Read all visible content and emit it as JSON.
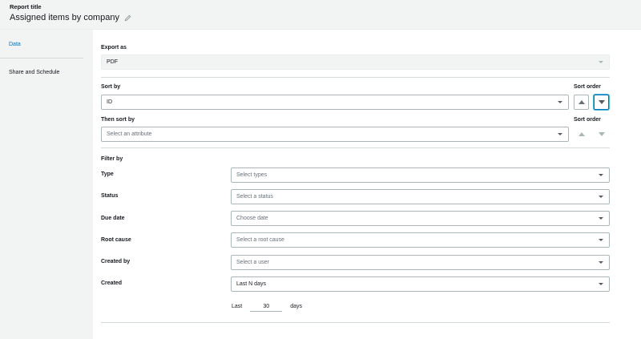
{
  "header": {
    "label": "Report title",
    "title": "Assigned items by company",
    "edit_icon": "pencil-icon"
  },
  "sidebar": {
    "items": [
      {
        "label": "Data",
        "active": true
      },
      {
        "label": "Share and Schedule",
        "active": false
      }
    ]
  },
  "export": {
    "label": "Export as",
    "value": "PDF"
  },
  "sort": {
    "label": "Sort by",
    "value": "ID",
    "order_label": "Sort order",
    "order": "descending"
  },
  "then_sort": {
    "label": "Then sort by",
    "placeholder": "Select an attribute",
    "order_label": "Sort order"
  },
  "filter": {
    "heading": "Filter by",
    "rows": [
      {
        "label": "Type",
        "placeholder": "Select types"
      },
      {
        "label": "Status",
        "placeholder": "Select a status"
      },
      {
        "label": "Due date",
        "placeholder": "Choose date"
      },
      {
        "label": "Root cause",
        "placeholder": "Select a root cause"
      },
      {
        "label": "Created by",
        "placeholder": "Select a user"
      },
      {
        "label": "Created",
        "value": "Last N days"
      }
    ],
    "days": {
      "prefix": "Last",
      "value": "30",
      "suffix": "days"
    }
  },
  "colors": {
    "accent": "#0073bb",
    "panel": "#f2f3f3",
    "border": "#aab7b8"
  }
}
